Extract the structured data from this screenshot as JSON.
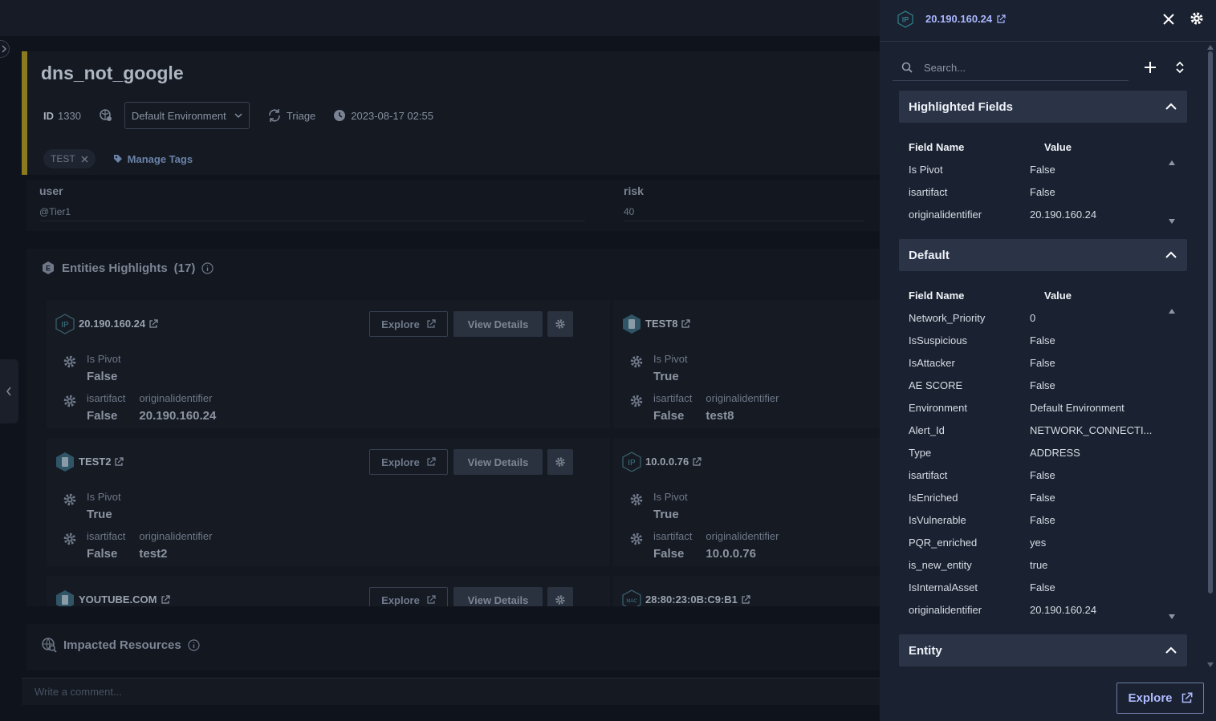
{
  "alert": {
    "title": "dns_not_google",
    "id_label": "ID",
    "id_value": "1330",
    "environment": "Default Environment",
    "stage": "Triage",
    "timestamp": "2023-08-17 02:55",
    "tag": "TEST",
    "manage_tags": "Manage Tags"
  },
  "user_risk": {
    "user_label": "user",
    "user_value": "@Tier1",
    "risk_label": "risk",
    "risk_value": "40"
  },
  "entities": {
    "title": "Entities Highlights",
    "count": "(17)",
    "explore_label": "Explore",
    "view_details_label": "View Details",
    "cards": [
      {
        "name": "20.190.160.24",
        "icon": "ip-icon",
        "f1_key": "Is Pivot",
        "f1_val": "False",
        "f2_key": "isartifact",
        "f2_val": "False",
        "f3_key": "originalidentifier",
        "f3_val": "20.190.160.24"
      },
      {
        "name": "TEST8",
        "icon": "host-icon",
        "f1_key": "Is Pivot",
        "f1_val": "True",
        "f2_key": "isartifact",
        "f2_val": "False",
        "f3_key": "originalidentifier",
        "f3_val": "test8"
      },
      {
        "name": "TEST2",
        "icon": "host-icon",
        "f1_key": "Is Pivot",
        "f1_val": "True",
        "f2_key": "isartifact",
        "f2_val": "False",
        "f3_key": "originalidentifier",
        "f3_val": "test2"
      },
      {
        "name": "10.0.0.76",
        "icon": "ip-icon",
        "f1_key": "Is Pivot",
        "f1_val": "True",
        "f2_key": "isartifact",
        "f2_val": "False",
        "f3_key": "originalidentifier",
        "f3_val": "10.0.0.76"
      },
      {
        "name": "YOUTUBE.COM",
        "icon": "host-icon"
      },
      {
        "name": "28:80:23:0B:C9:B1",
        "icon": "mac-icon"
      }
    ]
  },
  "impacted": {
    "title": "Impacted Resources"
  },
  "comment": {
    "placeholder": "Write a comment..."
  },
  "panel": {
    "title": "20.190.160.24",
    "badge": "IP",
    "search_placeholder": "Search...",
    "col_field": "Field Name",
    "col_value": "Value",
    "highlighted": {
      "title": "Highlighted Fields",
      "rows": [
        {
          "k": "Is Pivot",
          "v": "False"
        },
        {
          "k": "isartifact",
          "v": "False"
        },
        {
          "k": "originalidentifier",
          "v": "20.190.160.24"
        }
      ]
    },
    "default": {
      "title": "Default",
      "rows": [
        {
          "k": "Network_Priority",
          "v": "0"
        },
        {
          "k": "IsSuspicious",
          "v": "False"
        },
        {
          "k": "IsAttacker",
          "v": "False"
        },
        {
          "k": "AE SCORE",
          "v": "False"
        },
        {
          "k": "Environment",
          "v": "Default Environment"
        },
        {
          "k": "Alert_Id",
          "v": "NETWORK_CONNECTI..."
        },
        {
          "k": "Type",
          "v": "ADDRESS"
        },
        {
          "k": "isartifact",
          "v": "False"
        },
        {
          "k": "IsEnriched",
          "v": "False"
        },
        {
          "k": "IsVulnerable",
          "v": "False"
        },
        {
          "k": "PQR_enriched",
          "v": "yes"
        },
        {
          "k": "is_new_entity",
          "v": "true"
        },
        {
          "k": "IsInternalAsset",
          "v": "False"
        },
        {
          "k": "originalidentifier",
          "v": "20.190.160.24"
        }
      ]
    },
    "entity": {
      "title": "Entity"
    },
    "explore_label": "Explore"
  },
  "colors": {
    "accent": "#a9b6ff",
    "tag_bar": "#8a7a20",
    "panel_bg": "#1a2130",
    "section_header": "#2b3447"
  }
}
